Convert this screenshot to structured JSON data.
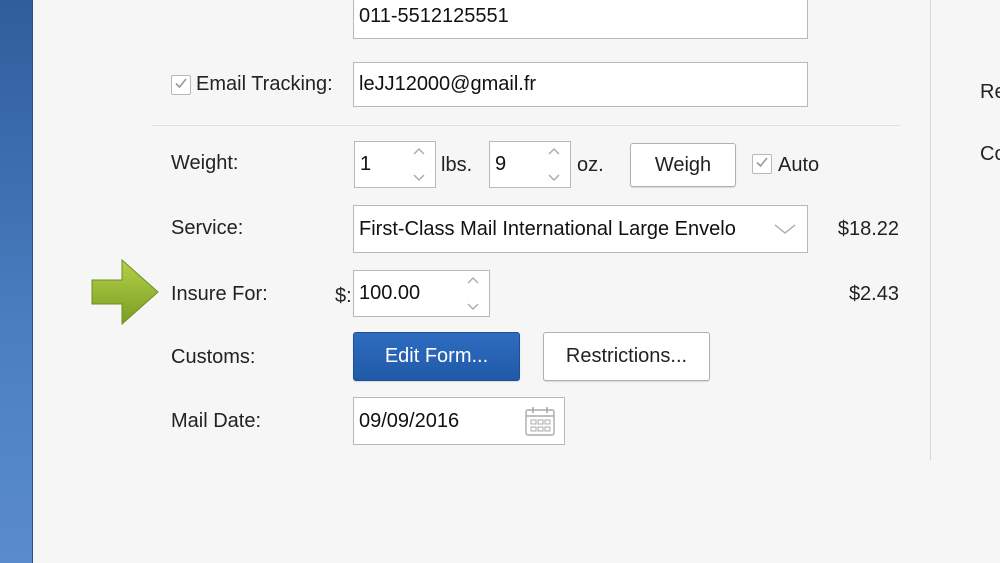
{
  "colors": {
    "accent": "#205aa8",
    "arrow": "#8fb331",
    "sidebar": "#3d6fb0"
  },
  "phone": {
    "value": "011-5512125551"
  },
  "email_tracking": {
    "checked": true,
    "label": "Email Tracking:",
    "value": "leJJ12000@gmail.fr"
  },
  "weight": {
    "label": "Weight:",
    "lbs_value": "1",
    "lbs_unit": "lbs.",
    "oz_value": "9",
    "oz_unit": "oz.",
    "weigh_button": "Weigh",
    "auto_checked": true,
    "auto_label": "Auto"
  },
  "service": {
    "label": "Service:",
    "selected": "First-Class Mail International Large Envelo",
    "price": "$18.22"
  },
  "insure": {
    "label": "Insure For:",
    "currency": "$:",
    "value": "100.00",
    "price": "$2.43"
  },
  "customs": {
    "label": "Customs:",
    "edit_button": "Edit Form...",
    "restrictions_button": "Restrictions..."
  },
  "mail_date": {
    "label": "Mail Date:",
    "value": "09/09/2016"
  },
  "right_panel": {
    "label_1": "Re",
    "label_2": "Co"
  },
  "icons": {
    "arrow": "right-arrow-icon",
    "calendar": "calendar-icon",
    "check": "checkmark-icon",
    "select": "chevron-down-icon",
    "stepper_up": "chevron-up-icon",
    "stepper_down": "chevron-down-icon"
  }
}
